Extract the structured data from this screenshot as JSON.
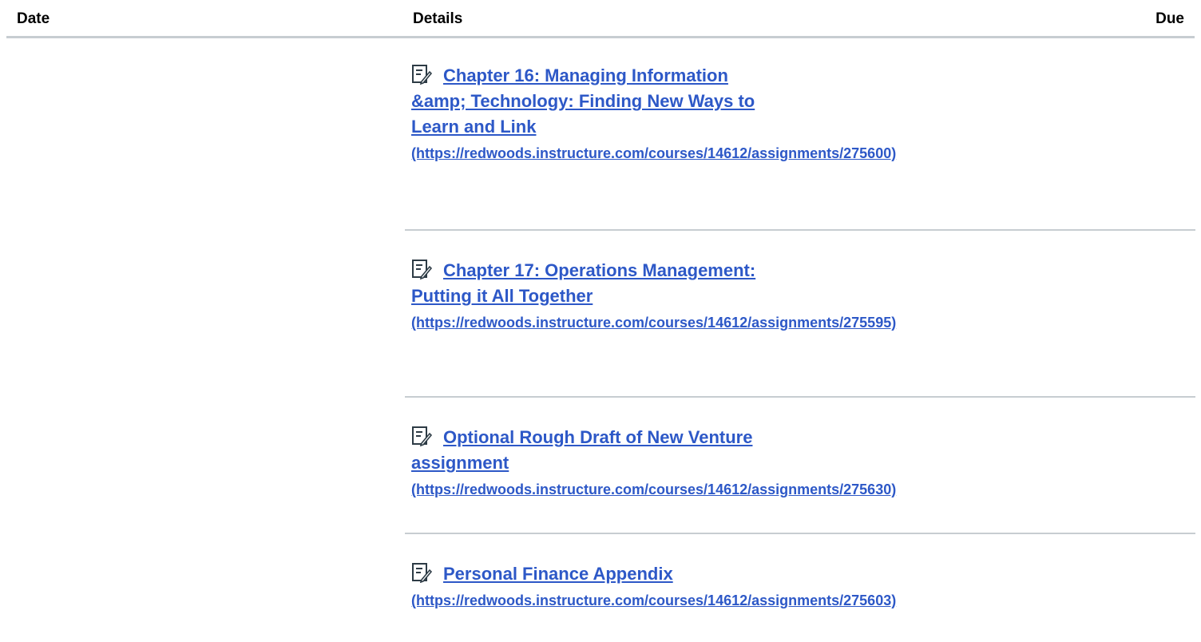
{
  "table": {
    "headers": {
      "date": "Date",
      "details": "Details",
      "due": "Due"
    },
    "rows": [
      {
        "icon": "assignment-icon",
        "title": "Chapter 16: Managing Information &amp; Technology: Finding New Ways to Learn and Link",
        "url": "(https://redwoods.instructure.com/courses/14612/assignments/275600)"
      },
      {
        "icon": "assignment-icon",
        "title": "Chapter 17: Operations Management: Putting it All Together",
        "url": "(https://redwoods.instructure.com/courses/14612/assignments/275595)"
      },
      {
        "icon": "assignment-icon",
        "title": "Optional Rough Draft of New Venture assignment",
        "url": "(https://redwoods.instructure.com/courses/14612/assignments/275630)"
      },
      {
        "icon": "assignment-icon",
        "title": "Personal Finance Appendix",
        "url": "(https://redwoods.instructure.com/courses/14612/assignments/275603)"
      }
    ]
  },
  "colors": {
    "link": "#2d58c7",
    "divider": "#c7cdd1",
    "header_text": "#000000"
  }
}
